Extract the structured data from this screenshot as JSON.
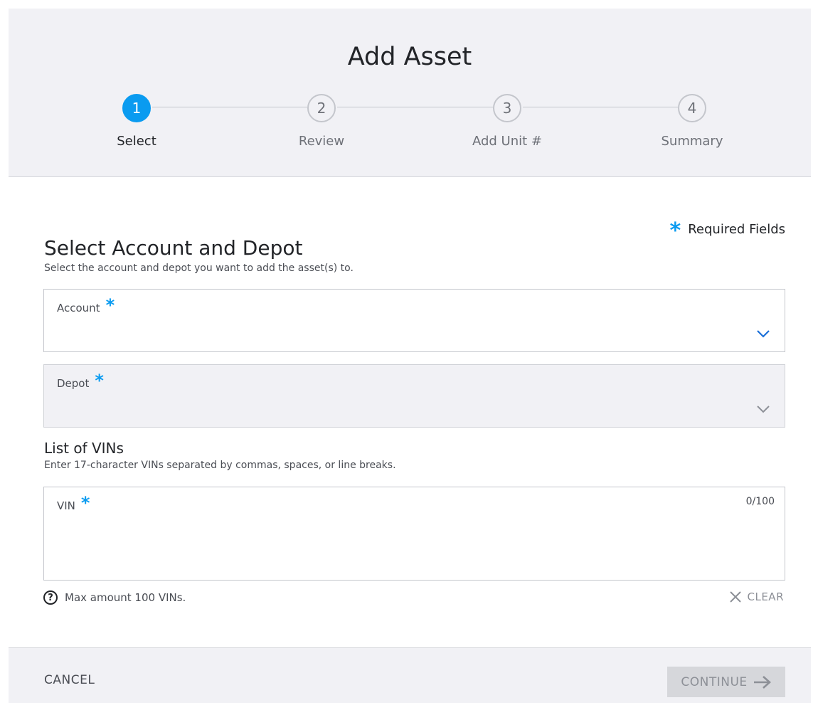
{
  "header": {
    "title": "Add Asset",
    "steps": [
      {
        "number": "1",
        "label": "Select",
        "active": true
      },
      {
        "number": "2",
        "label": "Review",
        "active": false
      },
      {
        "number": "3",
        "label": "Add Unit #",
        "active": false
      },
      {
        "number": "4",
        "label": "Summary",
        "active": false
      }
    ]
  },
  "form": {
    "required_legend": "Required Fields",
    "section_title": "Select Account and Depot",
    "section_subtitle": "Select the account and depot you want to add the asset(s) to.",
    "account_label": "Account",
    "account_value": "",
    "depot_label": "Depot",
    "depot_value": "",
    "list_title": "List of VINs",
    "list_subtitle": "Enter 17-character VINs separated by commas, spaces, or line breaks.",
    "vin_label": "VIN",
    "vin_value": "",
    "vin_counter": "0/100",
    "help_text": "Max amount 100 VINs.",
    "clear_label": "CLEAR"
  },
  "footer": {
    "cancel_label": "CANCEL",
    "continue_label": "CONTINUE"
  },
  "colors": {
    "accent": "#0a9bf0",
    "header_bg": "#f1f1f5",
    "disabled_bg": "#d6d7db"
  },
  "icons": {
    "required": "asterisk-icon",
    "dropdown": "chevron-down-icon",
    "help": "question-circle-icon",
    "clear": "close-icon",
    "continue": "arrow-right-icon"
  }
}
